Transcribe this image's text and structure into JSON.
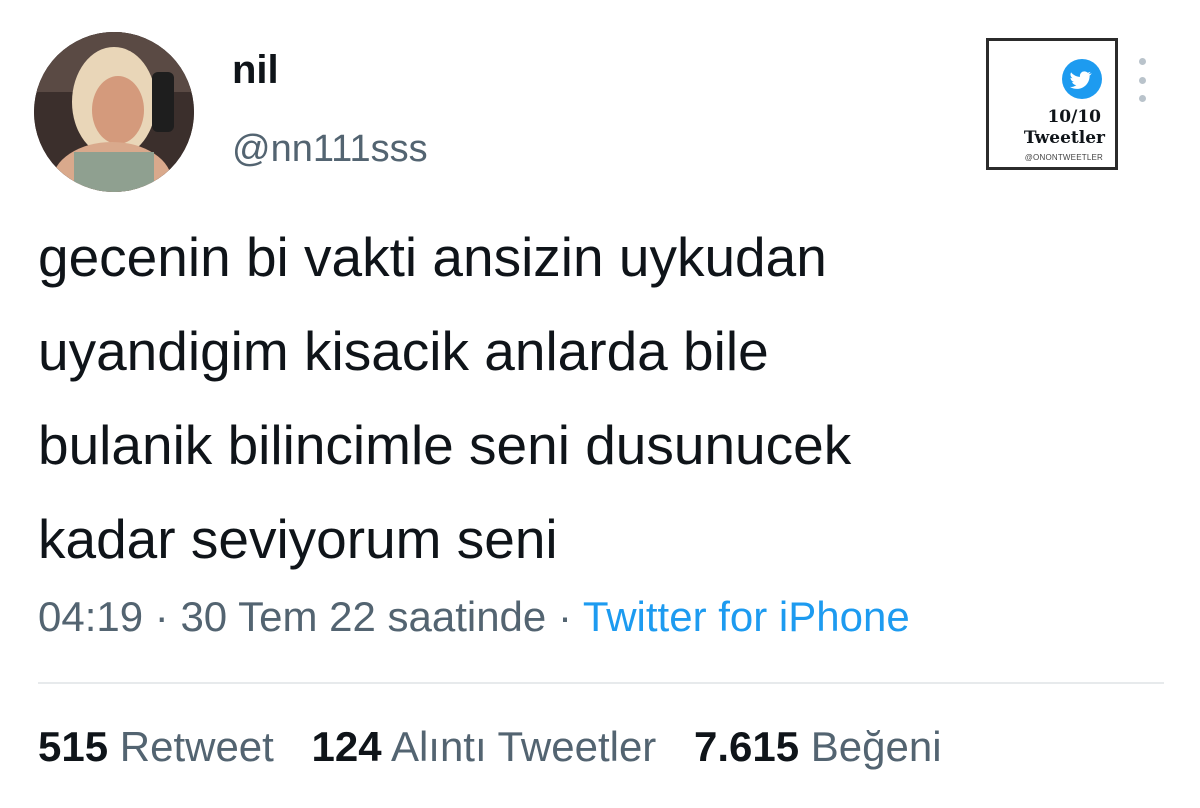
{
  "user": {
    "display_name": "nil",
    "handle": "@nn111sss"
  },
  "watermark": {
    "count": "10/10",
    "title": "Tweetler",
    "handle": "@ONONTWEETLER",
    "icon": "twitter-bird-icon"
  },
  "tweet": {
    "text": "gecenin bi vakti ansizin uykudan\nuyandigim kisacik anlarda bile\nbulanik bilincimle seni dusunucek\nkadar seviyorum seni",
    "time": "04:19",
    "separator": "·",
    "date": "30 Tem 22 saatinde",
    "source": "Twitter for iPhone"
  },
  "stats": {
    "retweets_count": "515",
    "retweets_label": "Retweet",
    "quotes_count": "124",
    "quotes_label": "Alıntı Tweetler",
    "likes_count": "7.615",
    "likes_label": "Beğeni"
  },
  "colors": {
    "text": "#0f1419",
    "muted": "#536471",
    "link": "#1d9bf0"
  }
}
